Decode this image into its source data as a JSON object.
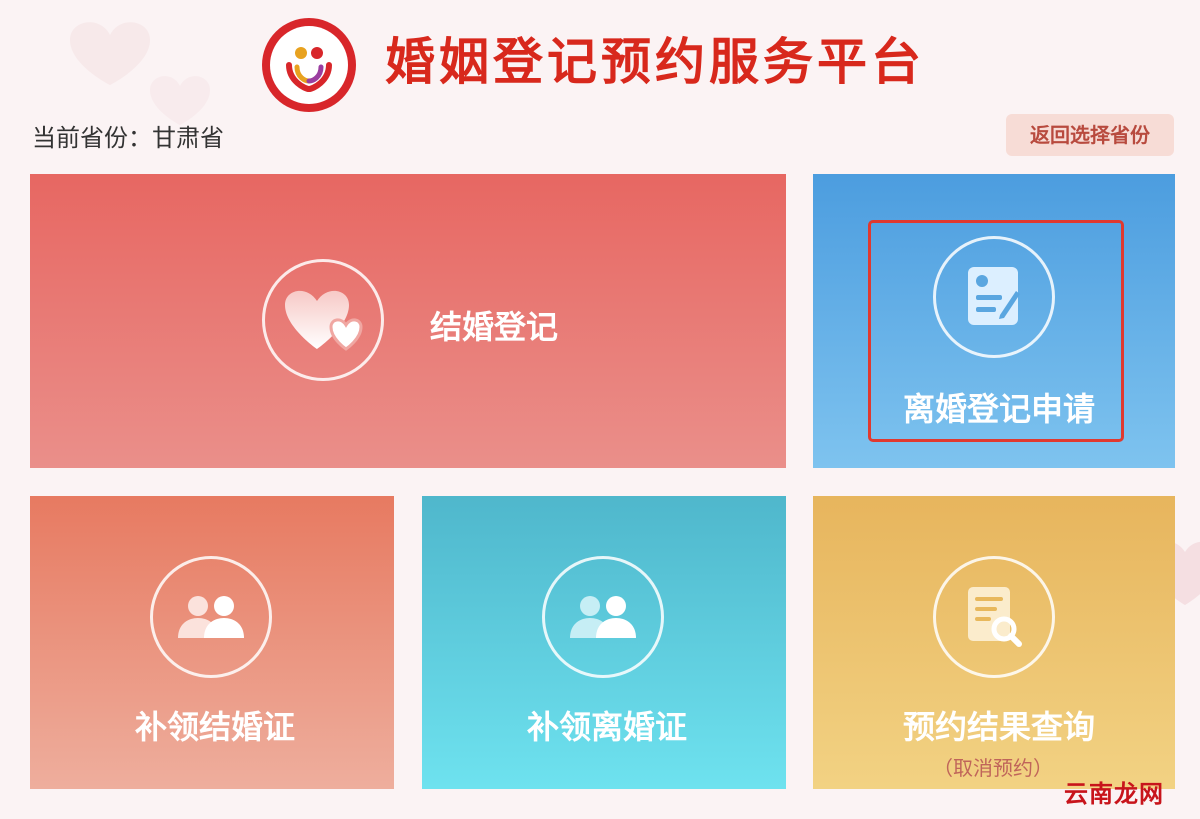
{
  "header": {
    "title": "婚姻登记预约服务平台",
    "province_label": "当前省份：甘肃省",
    "back_button": "返回选择省份"
  },
  "cards": {
    "marriage": {
      "label": "结婚登记",
      "icon": "hearts-icon"
    },
    "divorce": {
      "label": "离婚登记申请",
      "icon": "document-edit-icon"
    },
    "reissue_marriage": {
      "label": "补领结婚证",
      "icon": "users-icon"
    },
    "reissue_divorce": {
      "label": "补领离婚证",
      "icon": "users-icon"
    },
    "query": {
      "label": "预约结果查询",
      "sub": "（取消预约）",
      "icon": "document-search-icon"
    }
  },
  "watermark": "云南龙网",
  "colors": {
    "brand_red": "#d8281c",
    "marriage": "#e76762",
    "divorce": "#4c9ddf",
    "reissue_marriage": "#e77a61",
    "reissue_divorce": "#4fb7cc",
    "query": "#e7b55d",
    "highlight": "#e0392f"
  }
}
